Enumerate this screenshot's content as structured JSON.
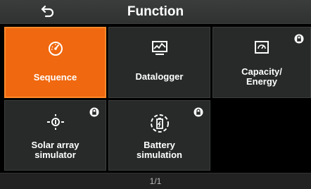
{
  "header": {
    "title": "Function"
  },
  "tiles": [
    {
      "label": "Sequence",
      "selected": true,
      "locked": false,
      "icon": "speedometer-icon"
    },
    {
      "label": "Datalogger",
      "selected": false,
      "locked": false,
      "icon": "monitor-chart-icon"
    },
    {
      "label": "Capacity/\nEnergy",
      "selected": false,
      "locked": true,
      "icon": "gauge-meter-icon"
    },
    {
      "label": "Solar array\nsimulator",
      "selected": false,
      "locked": true,
      "icon": "sun-icon"
    },
    {
      "label": "Battery\nsimulation",
      "selected": false,
      "locked": true,
      "icon": "battery-icon"
    }
  ],
  "footer": {
    "page_indicator": "1/1"
  },
  "colors": {
    "accent": "#f0680f",
    "tile_bg": "#272a29",
    "header_bg": "#353837"
  }
}
